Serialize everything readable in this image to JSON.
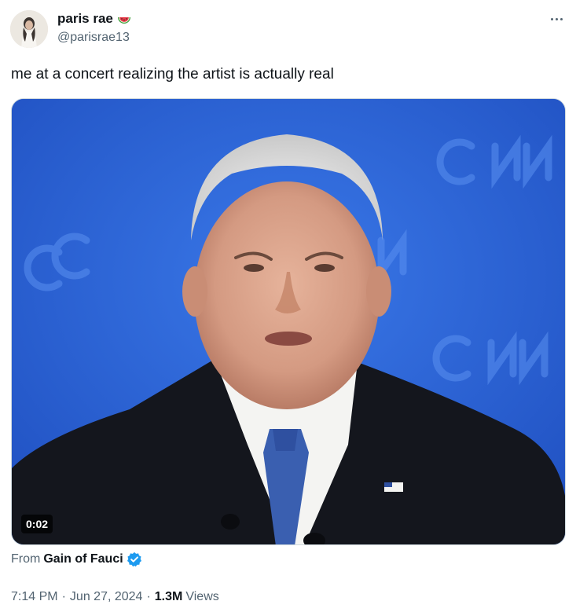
{
  "author": {
    "display_name": "paris rae",
    "handle": "@parisrae13",
    "name_emoji": "watermelon-icon"
  },
  "tweet": {
    "text": "me at a concert realizing the artist is actually real"
  },
  "media": {
    "duration": "0:02",
    "background_text": "CNN",
    "colors": {
      "backdrop": "#2f66d8",
      "suit": "#14161d",
      "tie": "#3a5fb0",
      "shirt": "#f4f4f2"
    }
  },
  "source": {
    "prefix": "From",
    "name": "Gain of Fauci",
    "verified": "verified-badge-icon",
    "verified_color": "#1d9bf0"
  },
  "meta": {
    "time": "7:14 PM",
    "separator": "·",
    "date": "Jun 27, 2024",
    "views_count": "1.3M",
    "views_label": "Views"
  },
  "colors": {
    "text_primary": "#0f1419",
    "text_secondary": "#536471"
  }
}
